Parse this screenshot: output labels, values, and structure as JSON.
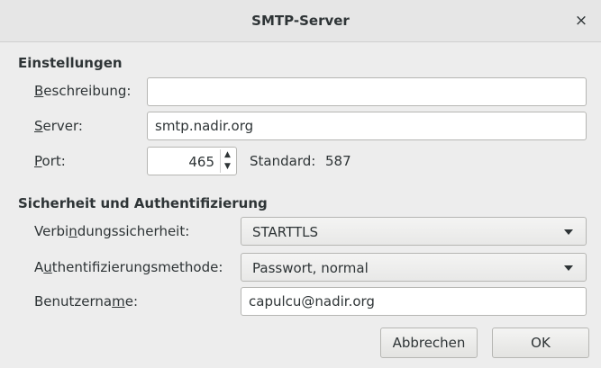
{
  "window": {
    "title": "SMTP-Server",
    "close_symbol": "×"
  },
  "settings": {
    "heading": "Einstellungen",
    "description": {
      "label": "Beschreibung:",
      "value": ""
    },
    "server": {
      "label": "Server:",
      "value": "smtp.nadir.org"
    },
    "port": {
      "label": "Port:",
      "value": "465",
      "default_label": "Standard:",
      "default_value": "587"
    }
  },
  "security": {
    "heading": "Sicherheit und Authentifizierung",
    "connection_security": {
      "label": "Verbindungssicherheit:",
      "value": "STARTTLS"
    },
    "auth_method": {
      "label": "Authentifizierungsmethode:",
      "value": "Passwort, normal"
    },
    "username": {
      "label": "Benutzername:",
      "value": "capulcu@nadir.org"
    }
  },
  "buttons": {
    "cancel": "Abbrechen",
    "ok": "OK"
  },
  "icons": {
    "spin_up": "up-arrow-icon",
    "spin_down": "down-arrow-icon",
    "dropdown": "chevron-down-icon",
    "close": "close-icon"
  },
  "colors": {
    "background": "#ededed",
    "titlebar": "#e6e6e6",
    "text": "#2e3436"
  }
}
